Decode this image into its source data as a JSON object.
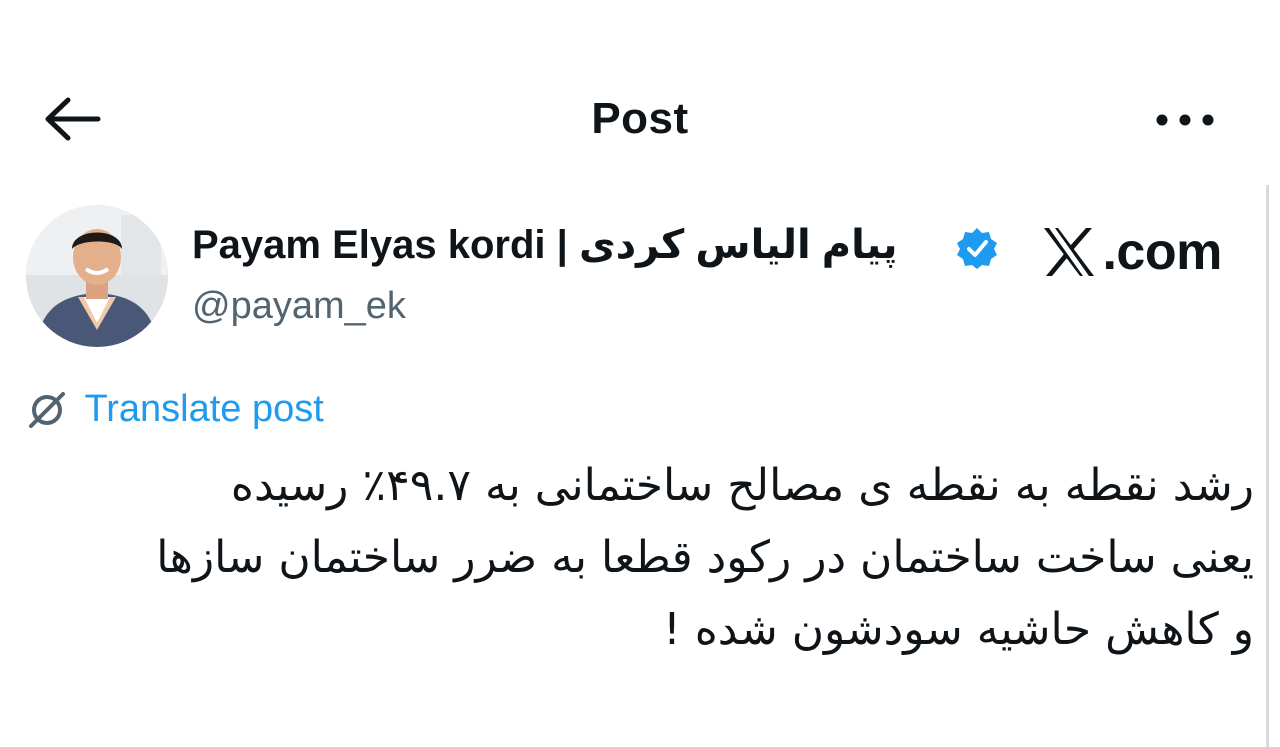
{
  "header": {
    "title": "Post",
    "back_icon": "arrow-left-icon",
    "more_icon": "ellipsis-icon"
  },
  "author": {
    "name": "Payam Elyas kordi | پیام الیاس کردی",
    "handle": "@payam_ek",
    "verified": true,
    "verified_color": "#1d9bf0"
  },
  "brand": {
    "text": ".com",
    "logo_icon": "x-logo-icon"
  },
  "translate": {
    "label": "Translate post",
    "icon": "translate-icon",
    "color": "#1d9bf0"
  },
  "post": {
    "lines": [
      "رشد نقطه به نقطه ی مصالح ساختمانی به ۴۹.۷٪ رسیده",
      "یعنی ساخت ساختمان در رکود قطعا به ضرر ساختمان سازها",
      "و کاهش حاشیه سودشون شده !"
    ]
  }
}
